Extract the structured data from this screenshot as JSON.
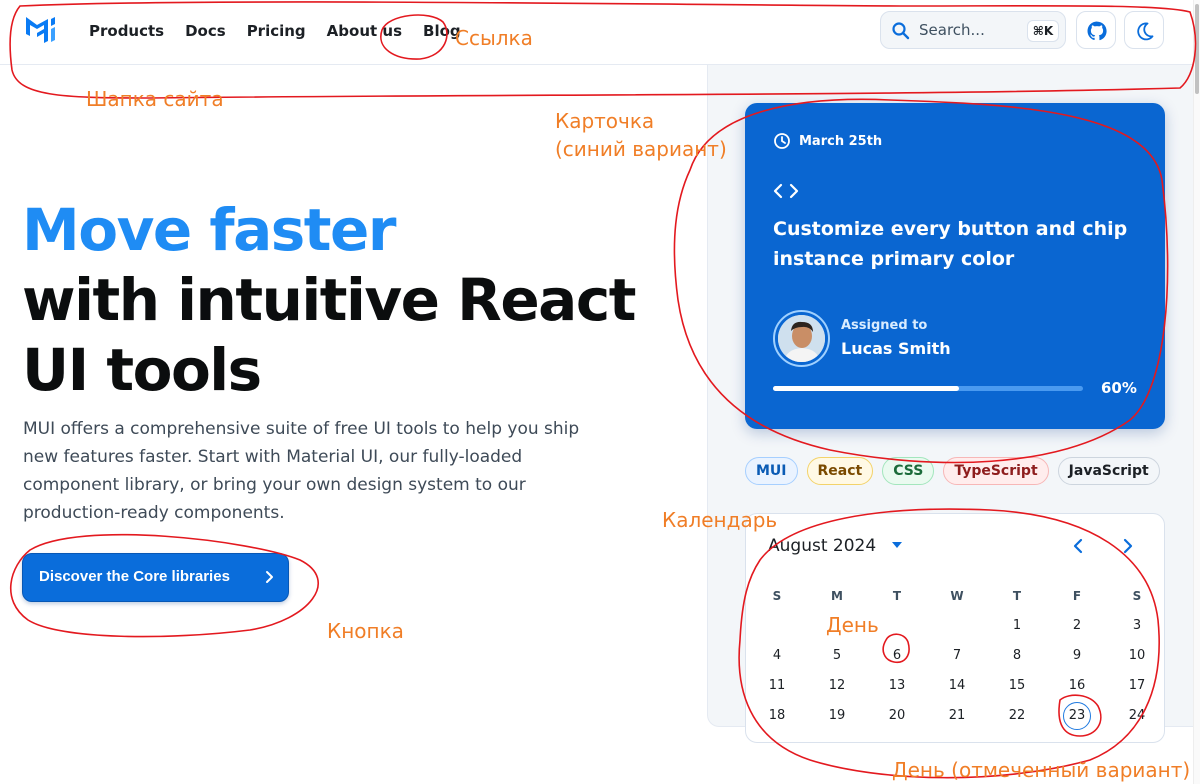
{
  "header": {
    "nav": [
      "Products",
      "Docs",
      "Pricing",
      "About us",
      "Blog"
    ],
    "search_placeholder": "Search...",
    "search_shortcut": "⌘K"
  },
  "hero": {
    "title_accent": "Move faster",
    "title_rest": "with intuitive React UI tools",
    "description": "MUI offers a comprehensive suite of free UI tools to help you ship new features faster. Start with Material UI, our fully-loaded component library, or bring your own design system to our production-ready components.",
    "cta_label": "Discover the Core libraries"
  },
  "card": {
    "date": "March 25th",
    "title": "Customize every button and chip instance primary color",
    "assigned_label": "Assigned to",
    "assignee": "Lucas Smith",
    "progress": 0.6,
    "progress_label": "60%"
  },
  "chips": [
    {
      "label": "MUI",
      "bg": "#eaf3ff",
      "border": "#a6cfff",
      "color": "#0a5bb5"
    },
    {
      "label": "React",
      "bg": "#fff9e5",
      "border": "#f3d36a",
      "color": "#7a4a00"
    },
    {
      "label": "CSS",
      "bg": "#eafaf0",
      "border": "#a3e6bd",
      "color": "#1b6b3a"
    },
    {
      "label": "TypeScript",
      "bg": "#ffeded",
      "border": "#f7b7b7",
      "color": "#8e1d1d"
    },
    {
      "label": "JavaScript",
      "bg": "#f3f6f9",
      "border": "#cdd5de",
      "color": "#1c2025"
    }
  ],
  "calendar": {
    "month_label": "August 2024",
    "weekdays": [
      "S",
      "M",
      "T",
      "W",
      "T",
      "F",
      "S"
    ],
    "weeks": [
      [
        "",
        "",
        "",
        "",
        "1",
        "2",
        "3"
      ],
      [
        "4",
        "5",
        "6",
        "7",
        "8",
        "9",
        "10"
      ],
      [
        "11",
        "12",
        "13",
        "14",
        "15",
        "16",
        "17"
      ],
      [
        "18",
        "19",
        "20",
        "21",
        "22",
        "23",
        "24"
      ]
    ],
    "selected_day": "23"
  },
  "annotations": {
    "link": "Ссылка",
    "header": "Шапка сайта",
    "card_line1": "Карточка",
    "card_line2": "(синий вариант)",
    "calendar": "Календарь",
    "day": "День",
    "button": "Кнопка",
    "day_selected": "День (отмеченный вариант)"
  },
  "colors": {
    "accent": "#1f8cf4",
    "primary": "#0a6ddb",
    "card_bg": "#0a66d1",
    "annotation_text": "#f07e27",
    "annotation_ink": "#e3191f"
  }
}
